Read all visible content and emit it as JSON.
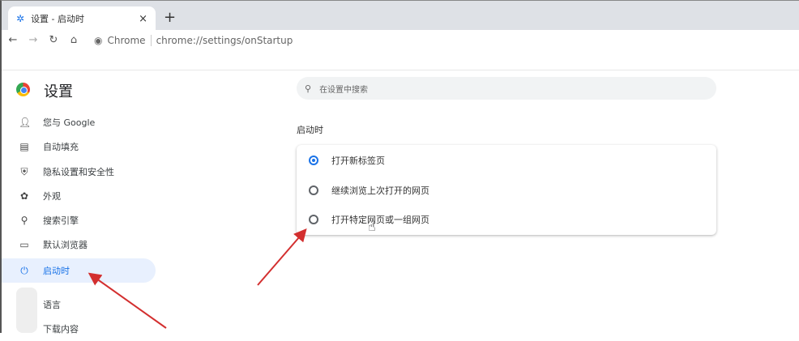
{
  "browser": {
    "tab_title": "设置 - 启动时",
    "new_tab": "+",
    "close": "×",
    "omnibox_chip": "Chrome",
    "url": "chrome://settings/onStartup"
  },
  "settings": {
    "title": "设置",
    "search_placeholder": "在设置中搜索",
    "nav": [
      {
        "label": "您与 Google",
        "icon": "person-icon"
      },
      {
        "label": "自动填充",
        "icon": "clipboard-icon"
      },
      {
        "label": "隐私设置和安全性",
        "icon": "shield-icon"
      },
      {
        "label": "外观",
        "icon": "palette-icon"
      },
      {
        "label": "搜索引擎",
        "icon": "search-icon"
      },
      {
        "label": "默认浏览器",
        "icon": "browser-icon"
      },
      {
        "label": "启动时",
        "icon": "power-icon",
        "selected": true
      },
      {
        "label": "语言",
        "icon": "globe-icon"
      },
      {
        "label": "下载内容",
        "icon": "download-icon"
      }
    ],
    "section_heading": "启动时",
    "options": [
      {
        "label": "打开新标签页",
        "selected": true
      },
      {
        "label": "继续浏览上次打开的网页",
        "selected": false
      },
      {
        "label": "打开特定网页或一组网页",
        "selected": false
      }
    ]
  },
  "colors": {
    "accent": "#1a73e8",
    "arrow": "#d32f2f"
  }
}
